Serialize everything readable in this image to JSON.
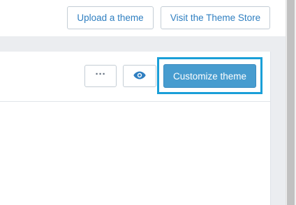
{
  "header": {
    "upload_label": "Upload a theme",
    "visit_label": "Visit the Theme Store"
  },
  "card": {
    "more_label": "···",
    "eye_icon": "eye-icon",
    "customize_label": "Customize theme"
  },
  "colors": {
    "accent": "#479ccf",
    "link": "#2f7fc1",
    "highlight": "#1a9fd8",
    "band": "#ebedf0"
  }
}
